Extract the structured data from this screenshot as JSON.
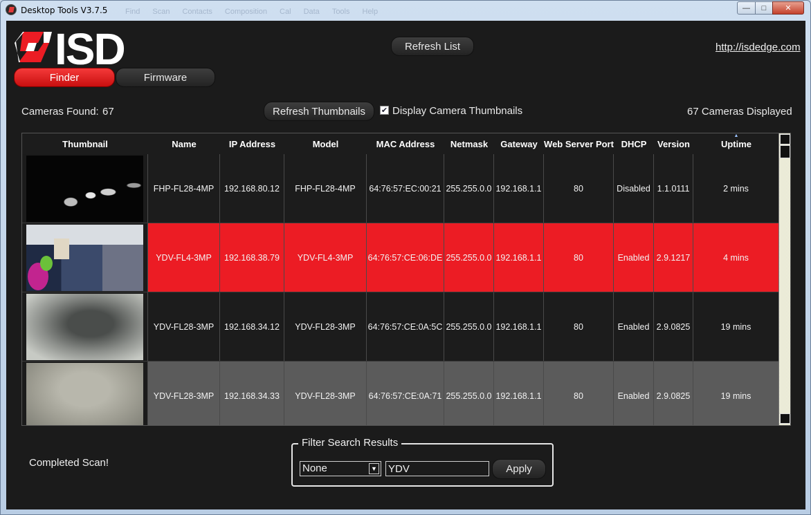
{
  "window": {
    "title": "Desktop Tools V3.7.5",
    "ghost_menu": [
      "Find",
      "Scan",
      "Contacts",
      "Composition",
      "Cal",
      "Data",
      "Tools",
      "Help"
    ]
  },
  "header": {
    "logo_text": "ISD",
    "tabs": [
      {
        "label": "Finder",
        "active": true
      },
      {
        "label": "Firmware",
        "active": false
      }
    ],
    "refresh_list_label": "Refresh List",
    "url": "http://isdedge.com"
  },
  "toolbar": {
    "cameras_found_label": "Cameras Found:",
    "cameras_found_count": "67",
    "refresh_thumbnails_label": "Refresh Thumbnails",
    "display_thumbnails_label": "Display Camera Thumbnails",
    "display_thumbnails_checked": true,
    "cameras_displayed": "67 Cameras Displayed"
  },
  "table": {
    "columns": [
      "Thumbnail",
      "Name",
      "IP Address",
      "Model",
      "MAC Address",
      "Netmask",
      "Gateway",
      "Web Server Port",
      "DHCP",
      "Version",
      "Uptime"
    ],
    "sorted_column": "Uptime",
    "rows": [
      {
        "name": "FHP-FL28-4MP",
        "ip": "192.168.80.12",
        "model": "FHP-FL28-4MP",
        "mac": "64:76:57:EC:00:21",
        "netmask": "255.255.0.0",
        "gateway": "192.168.1.1",
        "port": "80",
        "dhcp": "Disabled",
        "version": "1.1.0111",
        "uptime": "2 mins",
        "state": "normal",
        "thumb": "dark-lens"
      },
      {
        "name": "YDV-FL4-3MP",
        "ip": "192.168.38.79",
        "model": "YDV-FL4-3MP",
        "mac": "64:76:57:CE:06:DE",
        "netmask": "255.255.0.0",
        "gateway": "192.168.1.1",
        "port": "80",
        "dhcp": "Enabled",
        "version": "2.9.1217",
        "uptime": "4 mins",
        "state": "selected",
        "thumb": "office"
      },
      {
        "name": "YDV-FL28-3MP",
        "ip": "192.168.34.12",
        "model": "YDV-FL28-3MP",
        "mac": "64:76:57:CE:0A:5C",
        "netmask": "255.255.0.0",
        "gateway": "192.168.1.1",
        "port": "80",
        "dhcp": "Enabled",
        "version": "2.9.0825",
        "uptime": "19 mins",
        "state": "normal",
        "thumb": "grey-blur"
      },
      {
        "name": "YDV-FL28-3MP",
        "ip": "192.168.34.33",
        "model": "YDV-FL28-3MP",
        "mac": "64:76:57:CE:0A:71",
        "netmask": "255.255.0.0",
        "gateway": "192.168.1.1",
        "port": "80",
        "dhcp": "Enabled",
        "version": "2.9.0825",
        "uptime": "19 mins",
        "state": "hover",
        "thumb": "grey-flat"
      }
    ]
  },
  "footer": {
    "status": "Completed Scan!",
    "filter_legend": "Filter Search Results",
    "filter_field": "None",
    "filter_text": "YDV",
    "apply_label": "Apply"
  },
  "colors": {
    "accent": "#ec1c24",
    "background": "#1b1b1b",
    "hover_row": "#5a5a5a"
  }
}
